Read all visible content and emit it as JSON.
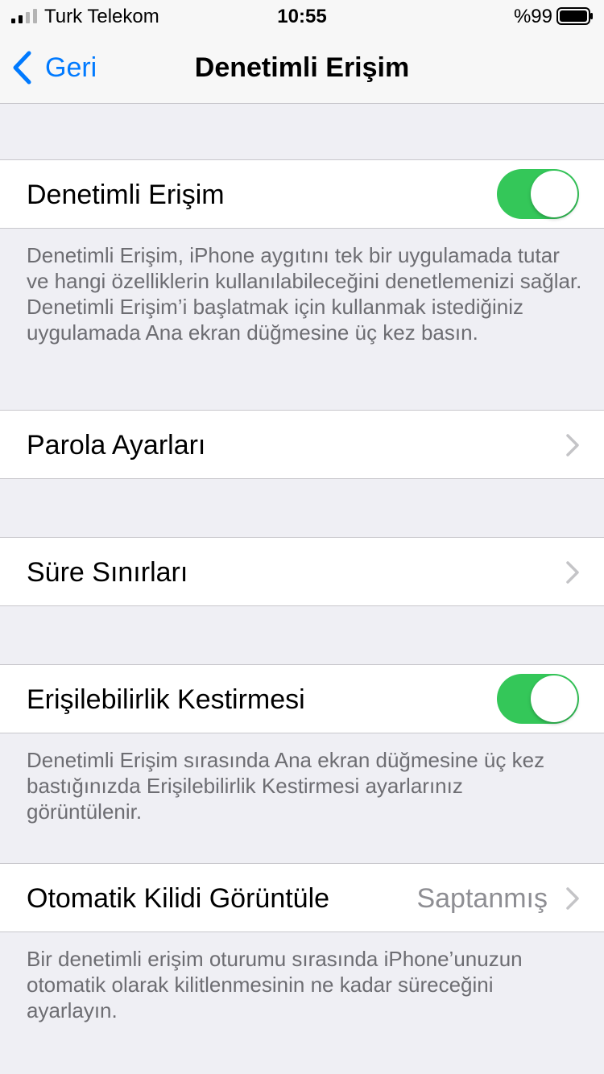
{
  "status_bar": {
    "carrier": "Turk Telekom",
    "time": "10:55",
    "battery_percent": "%99"
  },
  "nav": {
    "back_label": "Geri",
    "title": "Denetimli Erişim"
  },
  "cells": {
    "guided_access": {
      "label": "Denetimli Erişim",
      "toggle_on": true
    },
    "passcode_settings": {
      "label": "Parola Ayarları"
    },
    "time_limits": {
      "label": "Süre Sınırları"
    },
    "accessibility_shortcut": {
      "label": "Erişilebilirlik Kestirmesi",
      "toggle_on": true
    },
    "auto_lock": {
      "label": "Otomatik Kilidi Görüntüle",
      "value": "Saptanmış"
    }
  },
  "footers": {
    "guided_access": "Denetimli Erişim, iPhone aygıtını tek bir uygulamada tutar ve hangi özelliklerin kullanılabileceğini denetlemenizi sağlar. Denetimli Erişim’i başlatmak için kullanmak istediğiniz uygulamada Ana ekran düğmesine üç kez basın.",
    "accessibility_shortcut": "Denetimli Erişim sırasında Ana ekran düğmesine üç kez bastığınızda Erişilebilirlik Kestirmesi ayarlarınız görüntülenir.",
    "auto_lock": "Bir denetimli erişim oturumu sırasında iPhone’unuzun otomatik olarak kilitlenmesinin ne kadar süreceğini ayarlayın."
  },
  "colors": {
    "accent": "#007aff",
    "toggle_on": "#34c759",
    "background": "#efeff4",
    "secondary_text": "#6d6d72"
  }
}
